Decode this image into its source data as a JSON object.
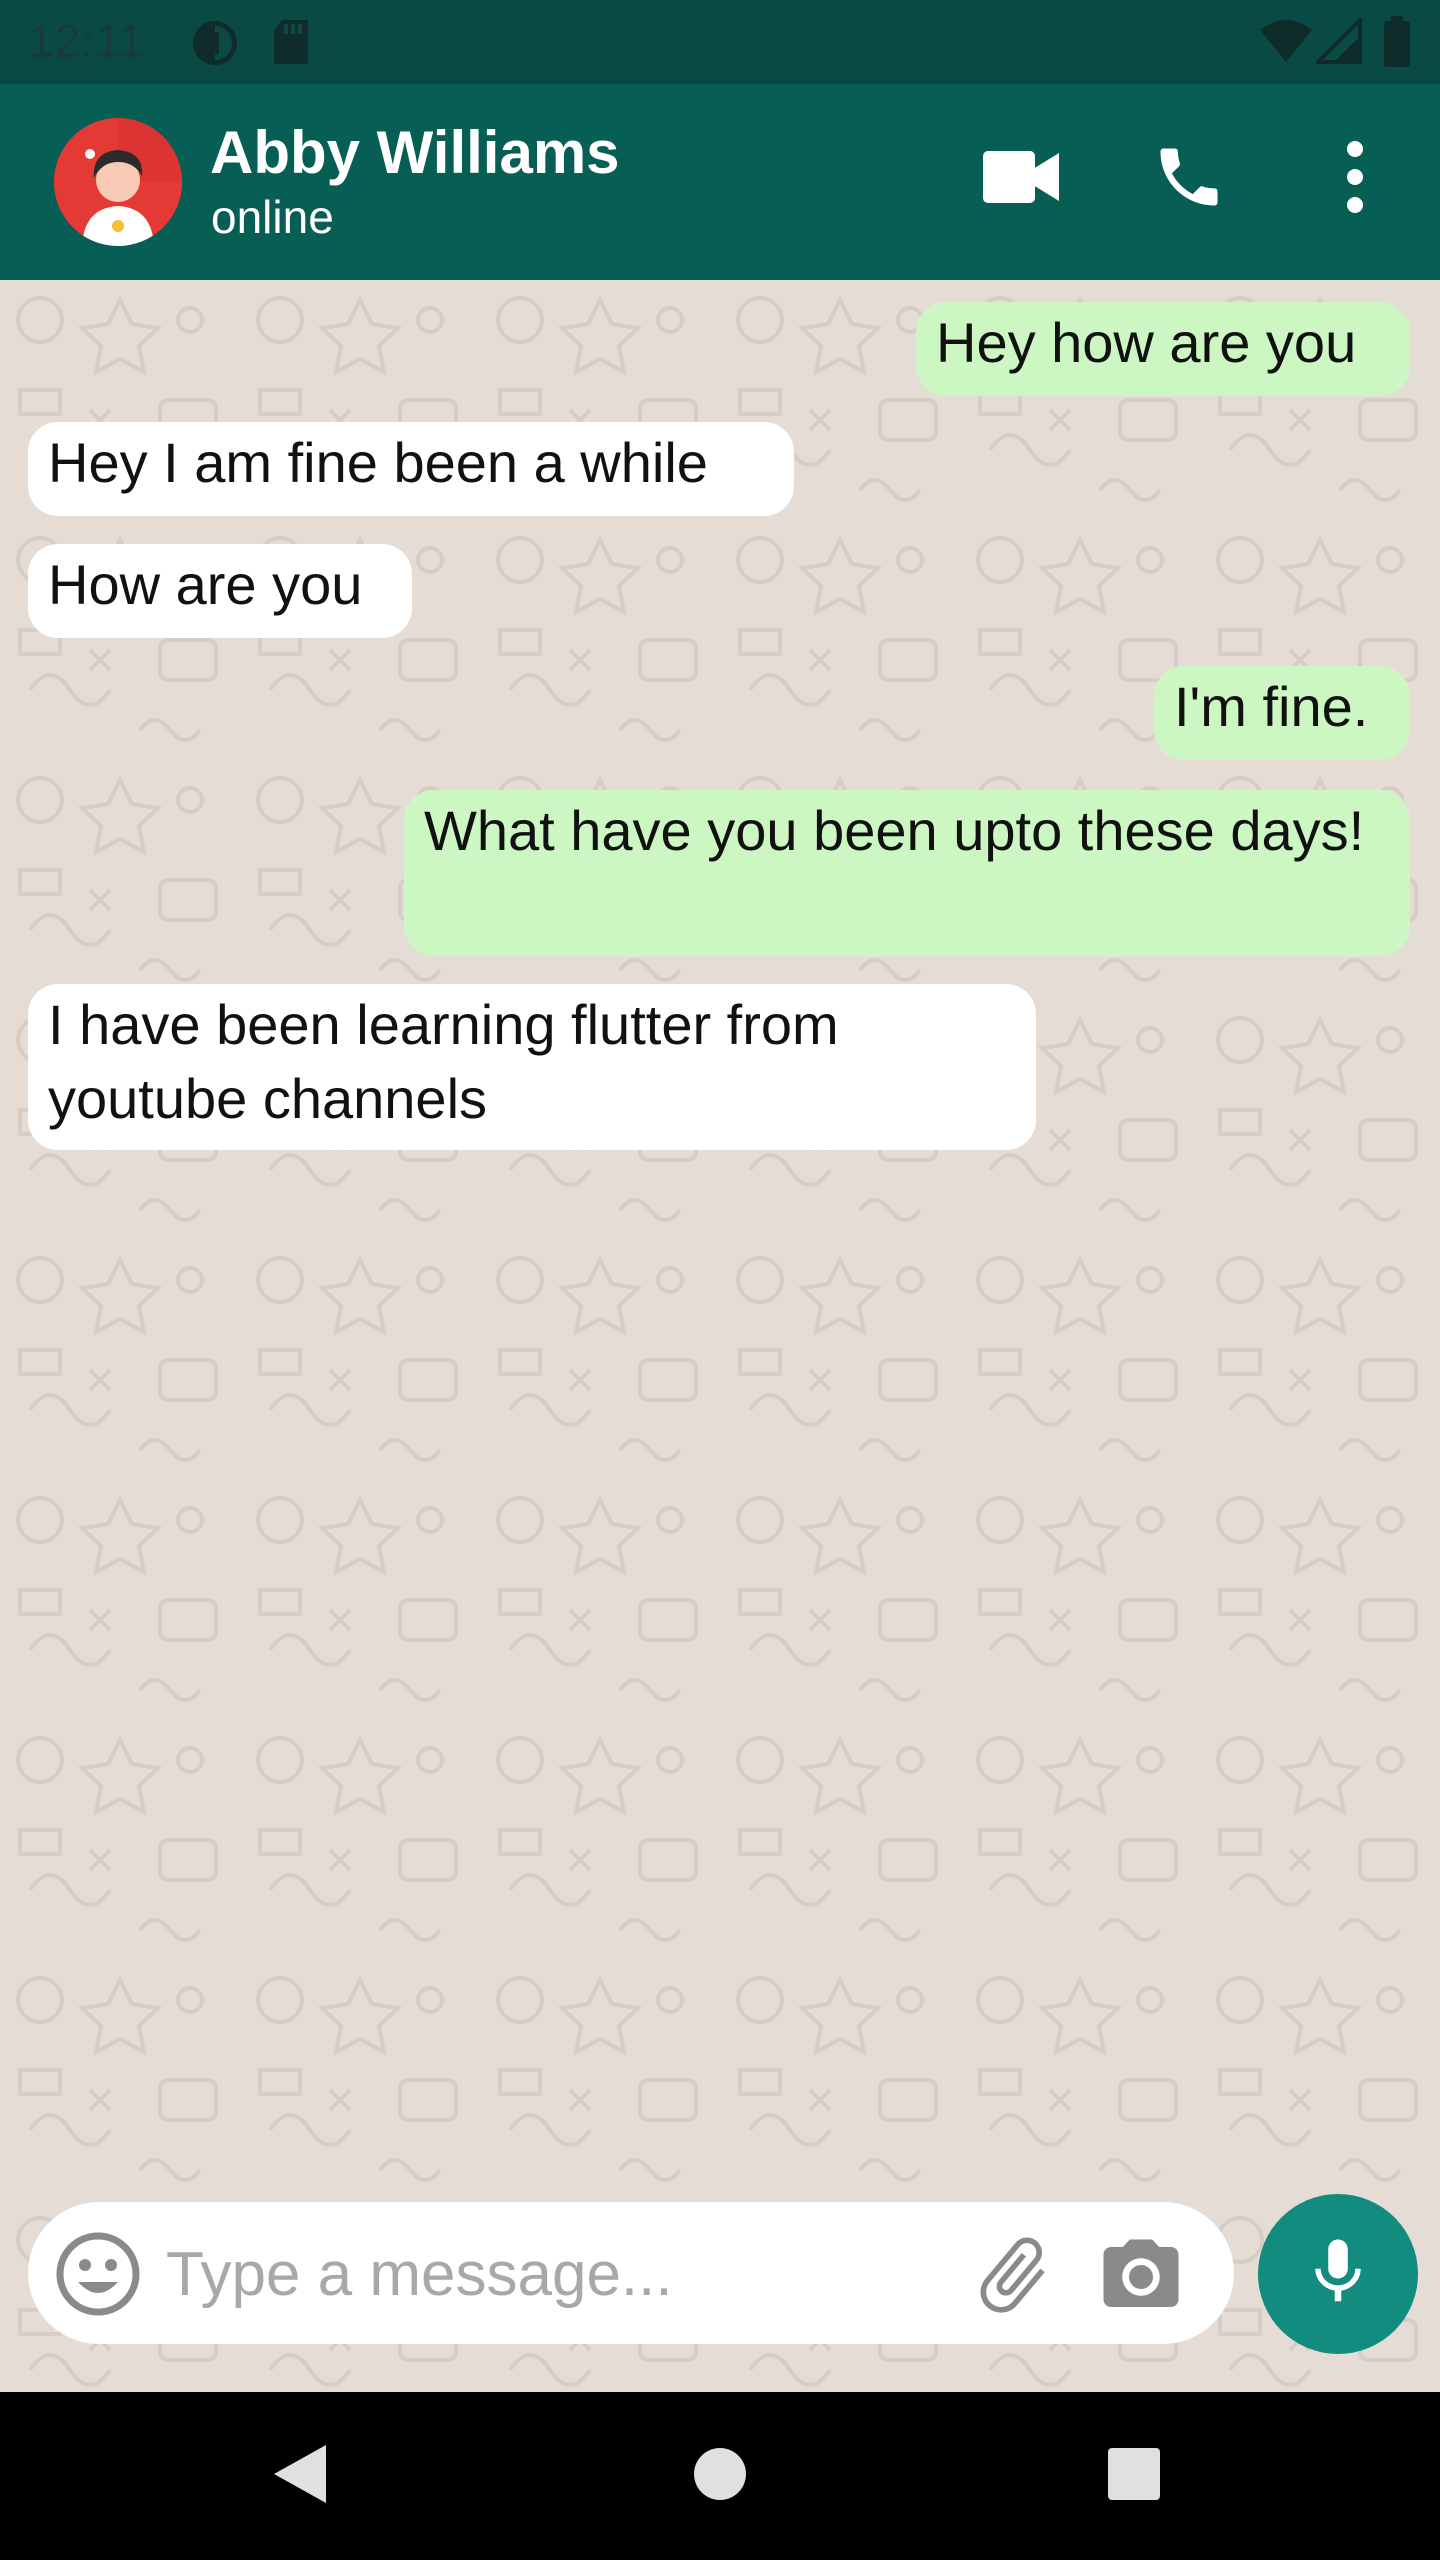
{
  "status_bar": {
    "time": "12:11",
    "icons": [
      "data-saver-icon",
      "sd-card-icon",
      "wifi-icon",
      "signal-icon",
      "battery-icon"
    ]
  },
  "header": {
    "contact_name": "Abby Williams",
    "contact_status": "online",
    "actions": [
      "video-call-icon",
      "phone-icon",
      "more-vert-icon"
    ]
  },
  "messages": [
    {
      "direction": "sent",
      "text": "Hey how are you"
    },
    {
      "direction": "received",
      "text": "Hey I am fine been a while"
    },
    {
      "direction": "received",
      "text": "How are you"
    },
    {
      "direction": "sent",
      "text": "I'm fine."
    },
    {
      "direction": "sent",
      "text": "What have you been upto these days!"
    },
    {
      "direction": "received",
      "text": "I have been learning flutter from youtube channels"
    }
  ],
  "composer": {
    "placeholder": "Type a message...",
    "value": "",
    "icons": [
      "emoji-icon",
      "attach-icon",
      "camera-icon",
      "mic-icon"
    ]
  },
  "colors": {
    "status_bar": "#0a4a45",
    "app_bar": "#075e54",
    "sent_bubble": "#ccf7c2",
    "received_bubble": "#ffffff",
    "chat_background": "#e5ddd5",
    "mic_button": "#128c7e"
  },
  "nav_bar": {
    "icons": [
      "back-icon",
      "home-icon",
      "recents-icon"
    ]
  }
}
